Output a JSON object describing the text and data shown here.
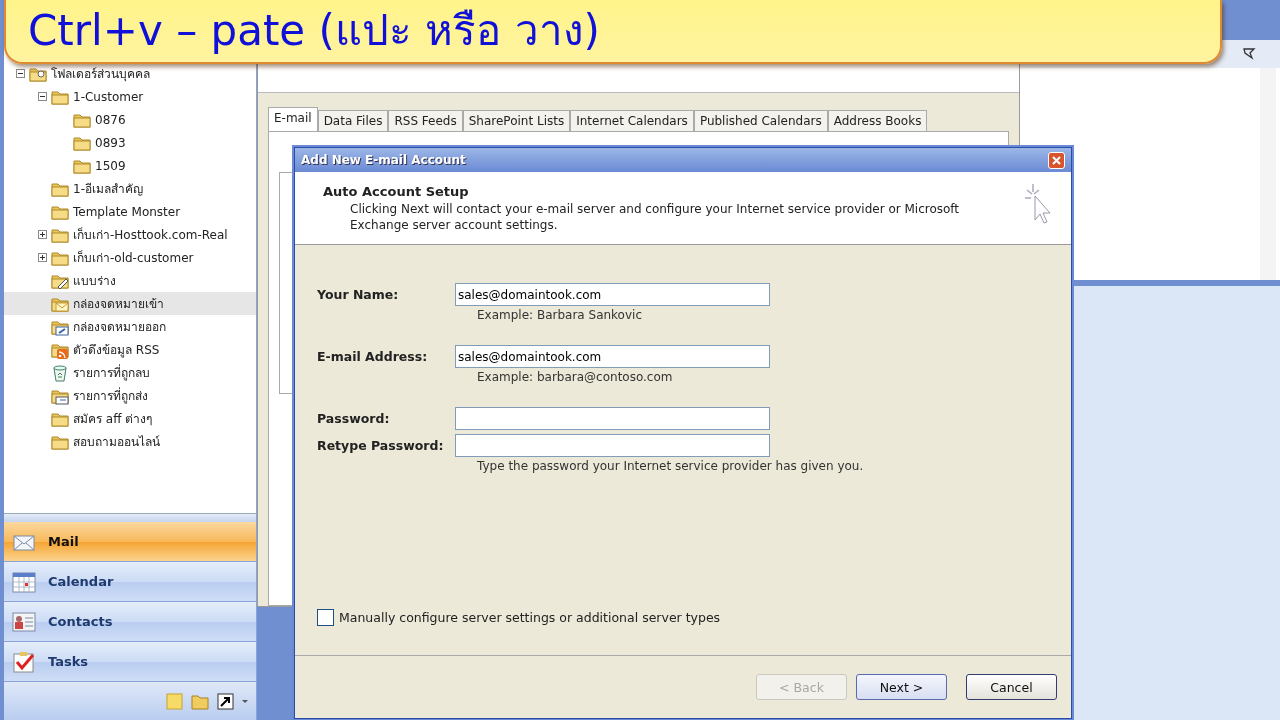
{
  "banner": {
    "text": "Ctrl+v – pate (แปะ หรือ วาง)"
  },
  "folder_tree": [
    {
      "label": "โฟลเดอร์ส่วนบุคคล",
      "kind": "personal",
      "expanded": true,
      "selected": false,
      "children": [
        {
          "label": "1-Customer",
          "kind": "folder",
          "expanded": true,
          "selected": false,
          "children": [
            {
              "label": "0876",
              "kind": "folder",
              "selected": false
            },
            {
              "label": "0893",
              "kind": "folder",
              "selected": false
            },
            {
              "label": "1509",
              "kind": "folder",
              "selected": false
            }
          ]
        },
        {
          "label": "1-อีเมลสำคัญ",
          "kind": "folder",
          "selected": false
        },
        {
          "label": "Template Monster",
          "kind": "folder",
          "selected": false
        },
        {
          "label": "เก็บเก่า-Hosttook.com-Real",
          "kind": "folder",
          "expanded": false,
          "selected": false
        },
        {
          "label": "เก็บเก่า-old-customer",
          "kind": "folder",
          "expanded": false,
          "selected": false
        },
        {
          "label": "แบบร่าง",
          "kind": "drafts",
          "selected": false
        },
        {
          "label": "กล่องจดหมายเข้า",
          "kind": "inbox",
          "selected": true
        },
        {
          "label": "กล่องจดหมายออก",
          "kind": "outbox",
          "selected": false
        },
        {
          "label": "ตัวดึงข้อมูล RSS",
          "kind": "rss",
          "selected": false
        },
        {
          "label": "รายการที่ถูกลบ",
          "kind": "deleted",
          "selected": false
        },
        {
          "label": "รายการที่ถูกส่ง",
          "kind": "sent",
          "selected": false
        },
        {
          "label": "สมัคร aff ต่างๆ",
          "kind": "folder",
          "selected": false
        },
        {
          "label": "สอบถามออนไลน์",
          "kind": "folder",
          "selected": false
        }
      ]
    }
  ],
  "navigation": [
    {
      "label": "Mail",
      "kind": "mail",
      "selected": true
    },
    {
      "label": "Calendar",
      "kind": "calendar",
      "selected": false
    },
    {
      "label": "Contacts",
      "kind": "contacts",
      "selected": false
    },
    {
      "label": "Tasks",
      "kind": "tasks",
      "selected": false
    }
  ],
  "account_settings": {
    "tabs": [
      {
        "label": "E-mail",
        "selected": true
      },
      {
        "label": "Data Files",
        "selected": false
      },
      {
        "label": "RSS Feeds",
        "selected": false
      },
      {
        "label": "SharePoint Lists",
        "selected": false
      },
      {
        "label": "Internet Calendars",
        "selected": false
      },
      {
        "label": "Published Calendars",
        "selected": false
      },
      {
        "label": "Address Books",
        "selected": false
      }
    ]
  },
  "dialog": {
    "title": "Add New E-mail Account",
    "heading": "Auto Account Setup",
    "description": "Clicking Next will contact your e-mail server and configure your Internet service provider or Microsoft Exchange server account settings.",
    "fields": [
      {
        "label": "Your Name:",
        "value": "sales@domaintook.com",
        "hint": "Example: Barbara Sankovic"
      },
      {
        "label": "E-mail Address:",
        "value": "sales@domaintook.com",
        "hint": "Example: barbara@contoso.com"
      },
      {
        "label": "Password:"
      },
      {
        "label": "Retype Password:",
        "hint": "Type the password your Internet service provider has given you."
      }
    ],
    "manual_config": {
      "label": "Manually configure server settings or additional server types",
      "checked": false
    },
    "buttons": [
      {
        "label": "< Back",
        "disabled": true
      },
      {
        "label": "Next >",
        "disabled": false,
        "primary": true
      },
      {
        "label": "Cancel",
        "disabled": false
      }
    ]
  }
}
